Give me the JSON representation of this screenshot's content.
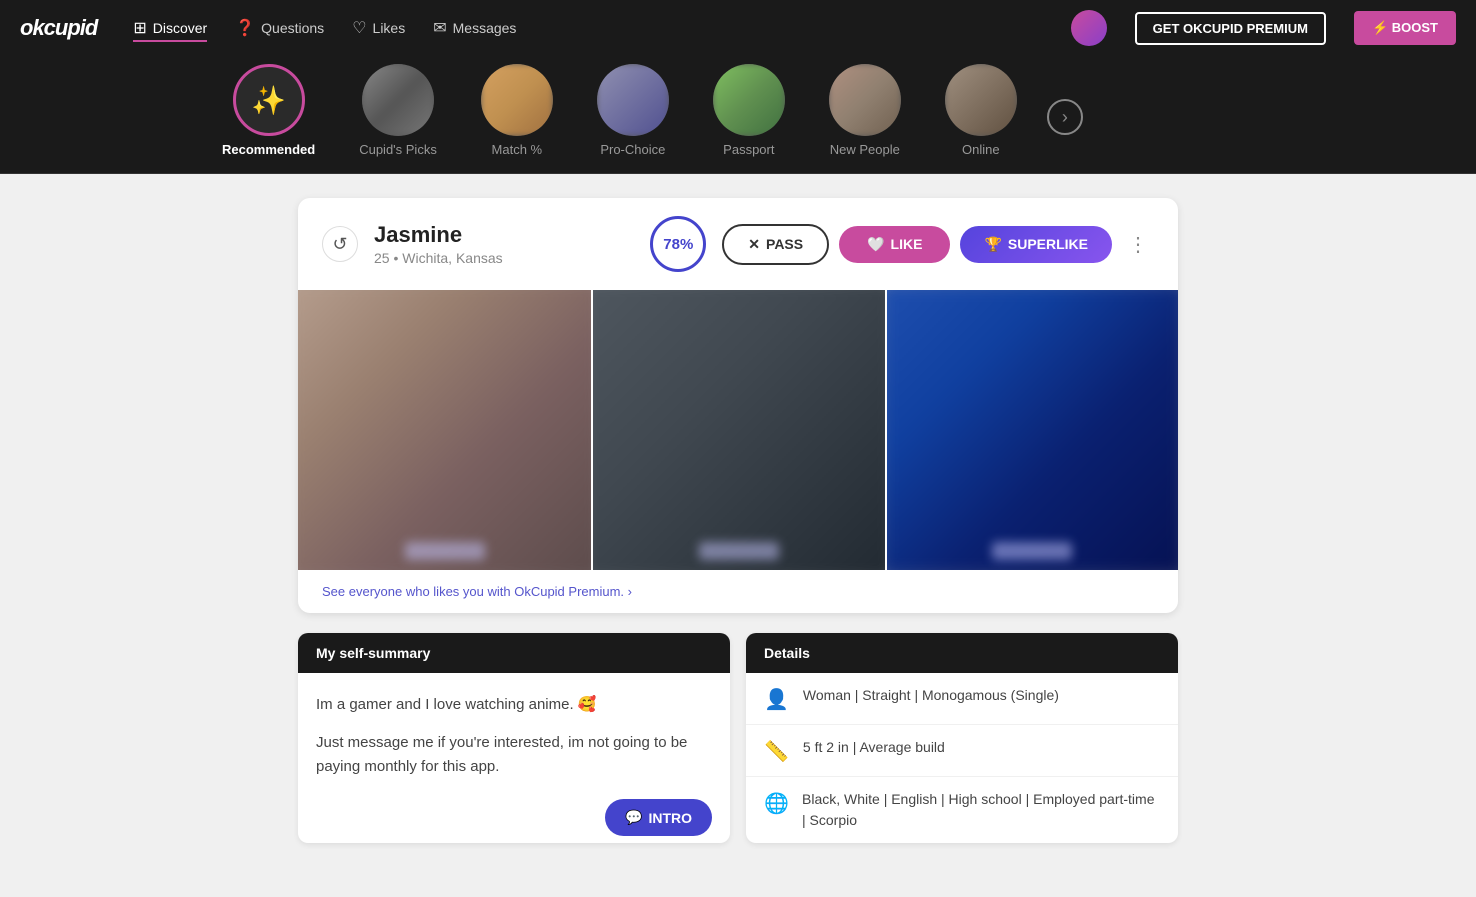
{
  "app": {
    "logo": "okcupid",
    "premium_btn": "GET OKCUPID PREMIUM",
    "boost_btn": "⚡ BOOST"
  },
  "nav": {
    "items": [
      {
        "id": "discover",
        "label": "Discover",
        "icon": "⊞",
        "active": true
      },
      {
        "id": "questions",
        "label": "Questions",
        "icon": "❓"
      },
      {
        "id": "likes",
        "label": "Likes",
        "icon": "♡"
      },
      {
        "id": "messages",
        "label": "Messages",
        "icon": "✉"
      }
    ]
  },
  "categories": [
    {
      "id": "recommended",
      "label": "Recommended",
      "active": true,
      "icon": "✨"
    },
    {
      "id": "cupids-picks",
      "label": "Cupid's Picks",
      "active": false
    },
    {
      "id": "match",
      "label": "Match %",
      "active": false
    },
    {
      "id": "pro-choice",
      "label": "Pro-Choice",
      "active": false
    },
    {
      "id": "passport",
      "label": "Passport",
      "active": false
    },
    {
      "id": "new-people",
      "label": "New People",
      "active": false
    },
    {
      "id": "online",
      "label": "Online",
      "active": false
    }
  ],
  "profile": {
    "name": "Jasmine",
    "age": "25",
    "location": "Wichita, Kansas",
    "match_pct": "78%",
    "pass_label": "PASS",
    "like_label": "LIKE",
    "superlike_label": "SUPERLIKE",
    "premium_link": "See everyone who likes you with OkCupid Premium. ›"
  },
  "self_summary": {
    "header": "My self-summary",
    "text1": "Im a gamer and I love watching anime. 🥰",
    "text2": "Just message me if you're interested, im not going to be paying monthly for this app.",
    "intro_btn": "INTRO"
  },
  "details": {
    "header": "Details",
    "rows": [
      {
        "icon": "👤",
        "text": "Woman | Straight | Monogamous (Single)"
      },
      {
        "icon": "📏",
        "text": "5 ft 2 in | Average build"
      },
      {
        "icon": "🌐",
        "text": "Black, White | English | High school | Employed part-time | Scorpio"
      }
    ]
  }
}
